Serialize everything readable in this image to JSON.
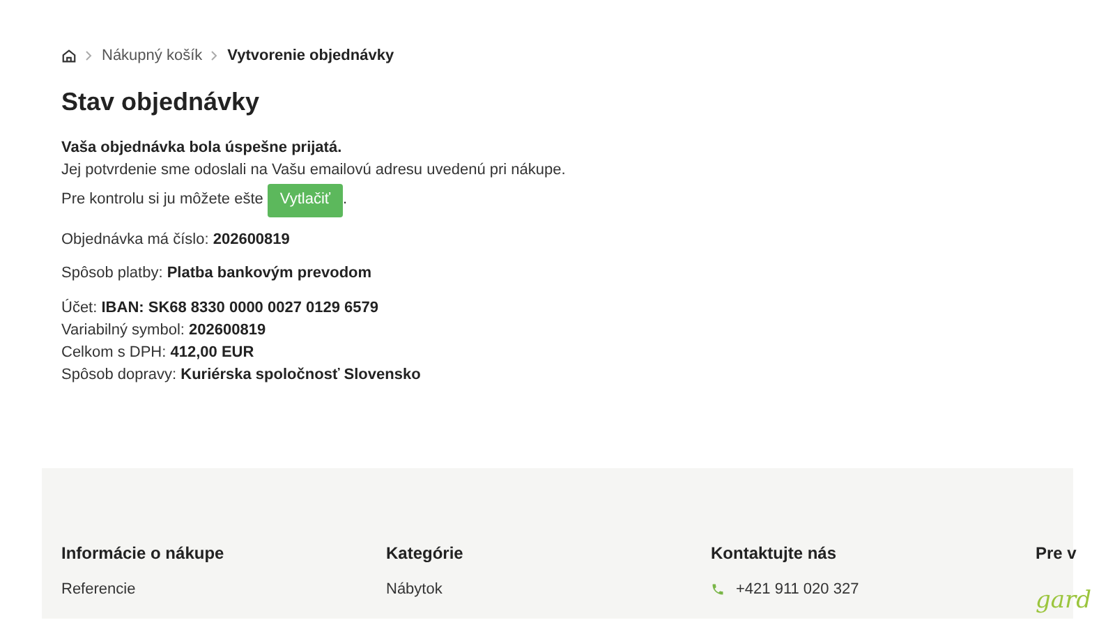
{
  "breadcrumb": [
    "Nákupný košík",
    "Vytvorenie objednávky"
  ],
  "title": "Stav objednávky",
  "message": {
    "headline": "Vaša objednávka bola úspešne prijatá.",
    "line": "Jej potvrdenie sme odoslali na Vašu emailovú adresu uvedenú pri nákupe.",
    "print_prefix": "Pre kontrolu si ju môžete ešte",
    "print_button": "Vytlačiť",
    "print_suffix": "."
  },
  "order_number": {
    "label": "Objednávka má číslo:",
    "value": "202600819"
  },
  "payment": {
    "label": "Spôsob platby:",
    "value": "Platba bankovým prevodom"
  },
  "details": [
    {
      "label": "Účet:",
      "value": "IBAN: SK68 8330 0000 0027 0129 6579"
    },
    {
      "label": "Variabilný symbol:",
      "value": "202600819"
    },
    {
      "label": "Celkom s DPH:",
      "value": "412,00 EUR"
    },
    {
      "label": "Spôsob dopravy:",
      "value": "Kuriérska spoločnosť Slovensko"
    }
  ],
  "footer": {
    "columns": [
      {
        "heading": "Informácie o nákupe",
        "items": [
          {
            "kind": "link",
            "text": "Referencie"
          }
        ]
      },
      {
        "heading": "Kategórie",
        "items": [
          {
            "kind": "link",
            "text": "Nábytok"
          }
        ]
      },
      {
        "heading": "Kontaktujte nás",
        "items": [
          {
            "kind": "phone",
            "text": "+421 911 020 327"
          }
        ]
      },
      {
        "heading": "Pre v",
        "items": [
          {
            "kind": "logo",
            "text": "gard"
          }
        ]
      }
    ]
  }
}
